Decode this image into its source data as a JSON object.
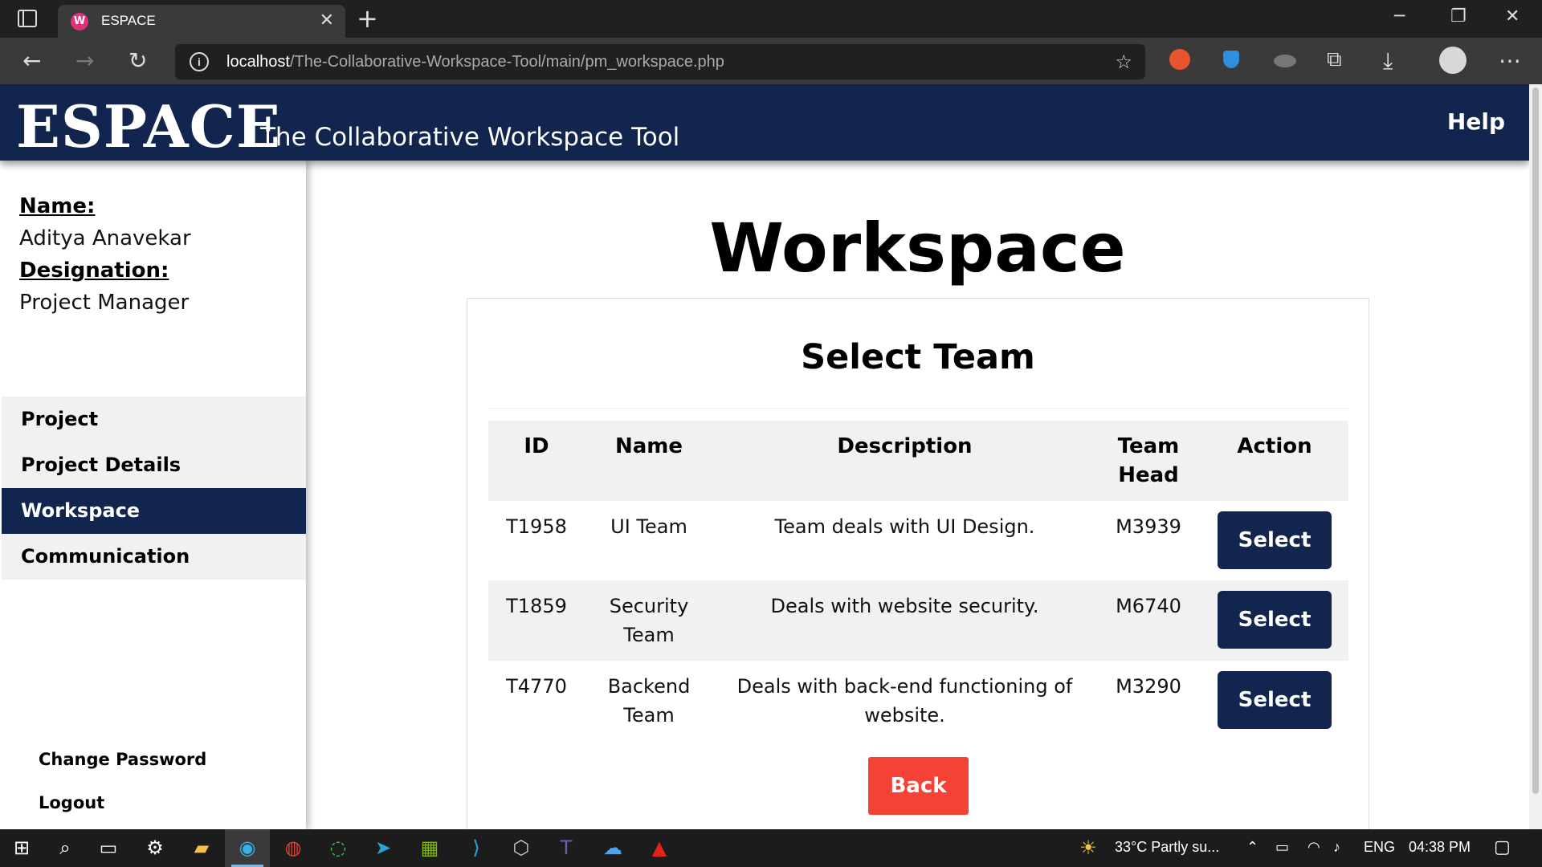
{
  "browser": {
    "tab_title": "ESPACE",
    "tab_favicon": "W",
    "url_host": "localhost",
    "url_path": "/The-Collaborative-Workspace-Tool/main/pm_workspace.php"
  },
  "header": {
    "logo": "ESPACE",
    "tagline": "The Collaborative Workspace Tool",
    "help": "Help"
  },
  "profile": {
    "name_label": "Name:",
    "name_value": "Aditya Anavekar",
    "designation_label": "Designation:",
    "designation_value": "Project Manager"
  },
  "nav": {
    "items": [
      {
        "label": "Project"
      },
      {
        "label": "Project Details"
      },
      {
        "label": "Workspace"
      },
      {
        "label": "Communication"
      }
    ],
    "active_index": 2
  },
  "footer_links": {
    "change_password": "Change Password",
    "logout": "Logout"
  },
  "main": {
    "title": "Workspace",
    "card_title": "Select Team",
    "columns": [
      "ID",
      "Name",
      "Description",
      "Team Head",
      "Action"
    ],
    "rows": [
      {
        "id": "T1958",
        "name": "UI Team",
        "description": "Team deals with UI Design.",
        "head": "M3939",
        "action": "Select"
      },
      {
        "id": "T1859",
        "name": "Security Team",
        "description": "Deals with website security.",
        "head": "M6740",
        "action": "Select"
      },
      {
        "id": "T4770",
        "name": "Backend Team",
        "description": "Deals with back-end functioning of website.",
        "head": "M3290",
        "action": "Select"
      }
    ],
    "back": "Back"
  },
  "taskbar": {
    "weather": "33°C  Partly su...",
    "language": "ENG",
    "time": "04:38 PM"
  },
  "colors": {
    "brand_navy": "#12254f",
    "back_red": "#f44336"
  }
}
